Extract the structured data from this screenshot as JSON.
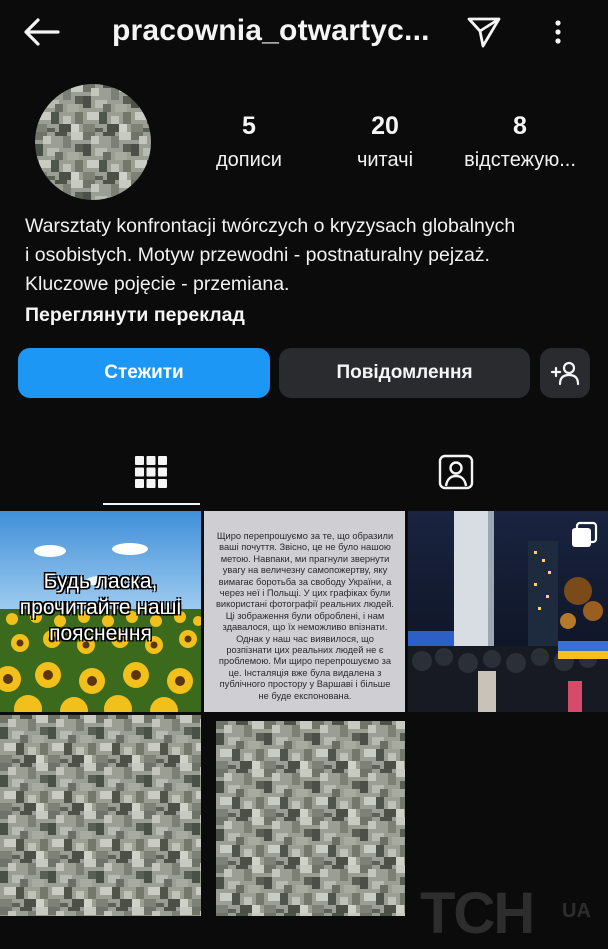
{
  "header": {
    "username": "pracownia_otwartyc..."
  },
  "stats": [
    {
      "value": "5",
      "label": "дописи"
    },
    {
      "value": "20",
      "label": "читачі"
    },
    {
      "value": "8",
      "label": "відстежую..."
    }
  ],
  "bio": {
    "line1": "Warsztaty konfrontacji twórczych o kryzysach globalnych",
    "line2": "i osobistych. Motyw przewodni - postnaturalny pejzaż.",
    "line3": "Kluczowe pojęcie - przemiana.",
    "translate_label": "Переглянути переклад"
  },
  "buttons": {
    "follow_label": "Стежити",
    "message_label": "Повідомлення"
  },
  "posts": {
    "p1_text": "Будь ласка, прочитайте наші пояснення",
    "p2_text": "Щиро перепрошуємо за те, що образили ваші почуття. Звісно, це не було нашою метою. Навпаки, ми прагнули звернути увагу на величезну самопожертву, яку вимагає боротьба за свободу України, а через неї і Польщі. У цих графіках були використані фотографії реальних людей. Ці зображення були оброблені, і нам здавалося, що їх неможливо впізнати. Однак у наш час виявилося, що розпізнати цих реальних людей не є проблемою. Ми щиро перепрошуємо за це. Інсталяція вже була видалена з публічного простору у Варшаві і більше не буде експонована."
  },
  "watermark": {
    "brand": "TCH",
    "suffix": "UA"
  },
  "colors": {
    "accent": "#1d97f5",
    "background": "#0b0b0c",
    "secondary_button": "#2a2b2e"
  }
}
